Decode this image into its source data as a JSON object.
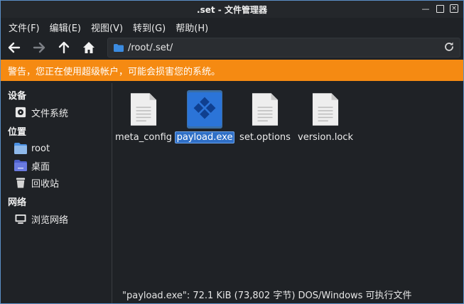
{
  "window": {
    "title": ".set - 文件管理器"
  },
  "menubar": {
    "items": [
      "文件(F)",
      "编辑(E)",
      "视图(V)",
      "转到(G)",
      "帮助(H)"
    ]
  },
  "toolbar": {
    "back_icon": "arrow-left-icon",
    "forward_icon": "arrow-right-icon",
    "up_icon": "arrow-up-icon",
    "home_icon": "home-icon",
    "path": "/root/.set/"
  },
  "warning": {
    "text": "警告，您正在使用超级帐户，可能会损害您的系统。",
    "color": "#f58a12"
  },
  "sidebar": {
    "devices_heading": "设备",
    "devices": [
      {
        "label": "文件系统",
        "icon": "drive-icon"
      }
    ],
    "places_heading": "位置",
    "places": [
      {
        "label": "root",
        "icon": "folder-home-icon"
      },
      {
        "label": "桌面",
        "icon": "desktop-folder-icon"
      },
      {
        "label": "回收站",
        "icon": "trash-icon"
      }
    ],
    "network_heading": "网络",
    "network": [
      {
        "label": "浏览网络",
        "icon": "network-icon"
      }
    ]
  },
  "files": [
    {
      "name": "meta_config",
      "icon": "text-file-icon",
      "selected": false
    },
    {
      "name": "payload.exe",
      "icon": "executable-file-icon",
      "selected": true
    },
    {
      "name": "set.options",
      "icon": "text-file-icon",
      "selected": false
    },
    {
      "name": "version.lock",
      "icon": "text-file-icon",
      "selected": false
    }
  ],
  "status": {
    "text": "\"payload.exe\": 72.1 KiB (73,802 字节) DOS/Windows 可执行文件"
  },
  "colors": {
    "accent": "#2f6fc6",
    "background": "#1f2226",
    "folder": "#3b8be0"
  }
}
